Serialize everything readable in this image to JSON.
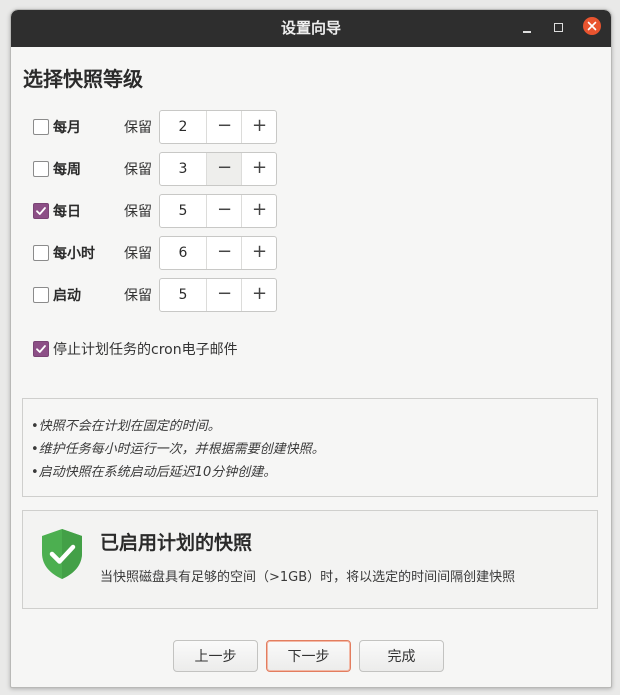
{
  "window": {
    "title": "设置向导"
  },
  "heading": "选择快照等级",
  "keep_label": "保留",
  "levels": [
    {
      "label": "每月",
      "checked": false,
      "value": "2"
    },
    {
      "label": "每周",
      "checked": false,
      "value": "3"
    },
    {
      "label": "每日",
      "checked": true,
      "value": "5"
    },
    {
      "label": "每小时",
      "checked": false,
      "value": "6"
    },
    {
      "label": "启动",
      "checked": false,
      "value": "5"
    }
  ],
  "stepper": {
    "minus": "−",
    "plus": "+"
  },
  "option": {
    "label": "停止计划任务的cron电子邮件",
    "checked": true
  },
  "info": [
    "•快照不会在计划在固定的时间。",
    "•维护任务每小时运行一次，并根据需要创建快照。",
    "•启动快照在系统启动后延迟10分钟创建。"
  ],
  "status": {
    "title": "已启用计划的快照",
    "description": "当快照磁盘具有足够的空间（>1GB）时，将以选定的时间间隔创建快照",
    "icon": "shield-check-icon",
    "color": "#4caf50"
  },
  "buttons": {
    "prev": "上一步",
    "next": "下一步",
    "finish": "完成"
  },
  "colors": {
    "accent": "#8c4f86",
    "close": "#e9542f",
    "titlebar": "#2e2e2e"
  }
}
